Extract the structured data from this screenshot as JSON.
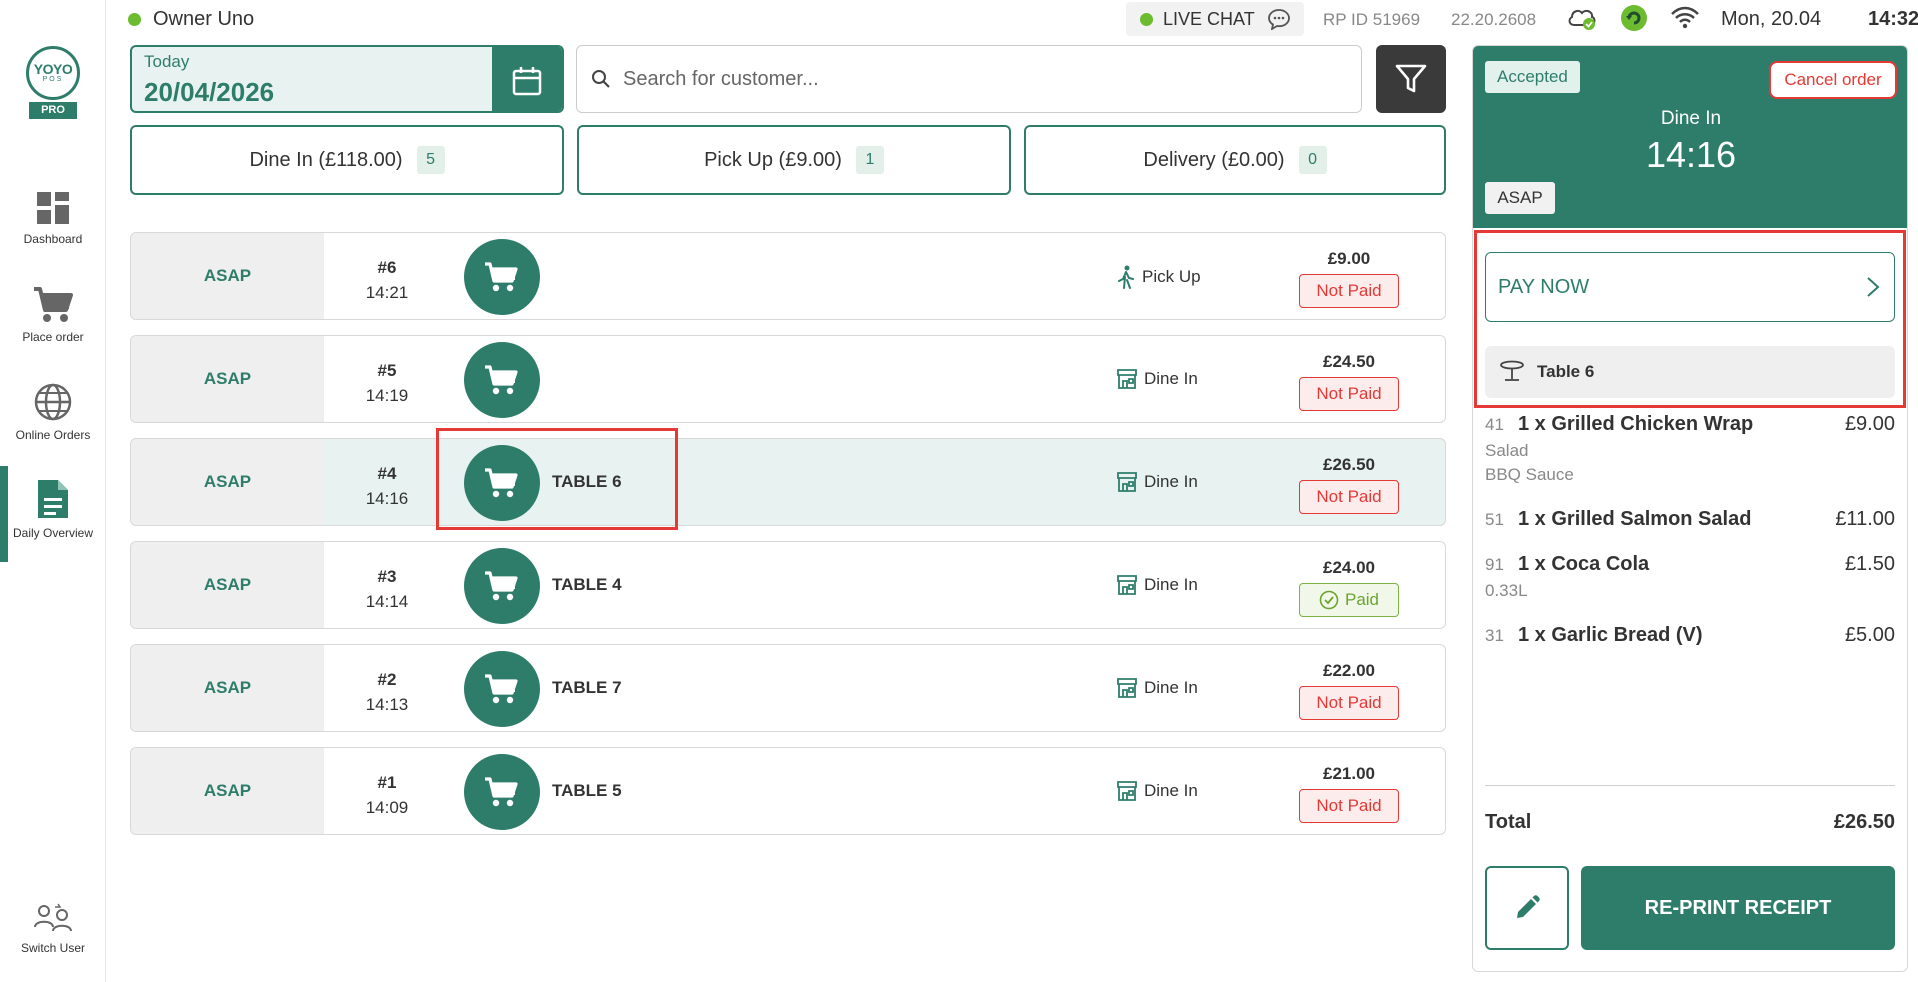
{
  "colors": {
    "brand": "#2e7d6b",
    "unpaid": "#e53935",
    "paid": "#6aa52f",
    "status_dot": "#6dbb2f",
    "highlight": "#e53935"
  },
  "logo": {
    "text": "YOYO",
    "sub": "POS",
    "pro": "PRO"
  },
  "sidebar": {
    "items": [
      {
        "label": "Dashboard",
        "icon": "dashboard-icon"
      },
      {
        "label": "Place order",
        "icon": "cart-icon"
      },
      {
        "label": "Online Orders",
        "icon": "globe-icon"
      },
      {
        "label": "Daily Overview",
        "icon": "document-icon",
        "active": true
      },
      {
        "label": "Switch User",
        "icon": "switch-user-icon"
      }
    ]
  },
  "topbar": {
    "owner": "Owner Uno",
    "live_chat": "LIVE CHAT",
    "rp_id": "RP ID 51969",
    "version": "22.20.2608",
    "date": "Mon, 20.04",
    "time": "14:32"
  },
  "date_filter": {
    "label": "Today",
    "value": "20/04/2026"
  },
  "search": {
    "placeholder": "Search for customer..."
  },
  "tabs": [
    {
      "label": "Dine In (£118.00)",
      "count": "5"
    },
    {
      "label": "Pick Up (£9.00)",
      "count": "1"
    },
    {
      "label": "Delivery (£0.00)",
      "count": "0"
    }
  ],
  "orders": [
    {
      "timing": "ASAP",
      "number": "#6",
      "time": "14:21",
      "table": "",
      "type": "Pick Up",
      "price": "£9.00",
      "status": "Not Paid"
    },
    {
      "timing": "ASAP",
      "number": "#5",
      "time": "14:19",
      "table": "",
      "type": "Dine In",
      "price": "£24.50",
      "status": "Not Paid"
    },
    {
      "timing": "ASAP",
      "number": "#4",
      "time": "14:16",
      "table": "TABLE 6",
      "type": "Dine In",
      "price": "£26.50",
      "status": "Not Paid"
    },
    {
      "timing": "ASAP",
      "number": "#3",
      "time": "14:14",
      "table": "TABLE 4",
      "type": "Dine In",
      "price": "£24.00",
      "status": "Paid"
    },
    {
      "timing": "ASAP",
      "number": "#2",
      "time": "14:13",
      "table": "TABLE 7",
      "type": "Dine In",
      "price": "£22.00",
      "status": "Not Paid"
    },
    {
      "timing": "ASAP",
      "number": "#1",
      "time": "14:09",
      "table": "TABLE 5",
      "type": "Dine In",
      "price": "£21.00",
      "status": "Not Paid"
    }
  ],
  "detail": {
    "status": "Accepted",
    "cancel_label": "Cancel order",
    "order_type": "Dine In",
    "time": "14:16",
    "timing": "ASAP",
    "pay_now": "PAY NOW",
    "table": "Table 6",
    "items": [
      {
        "code": "41",
        "name": "1 x Grilled Chicken Wrap",
        "price": "£9.00",
        "mods": [
          "Salad",
          "BBQ Sauce"
        ]
      },
      {
        "code": "51",
        "name": "1 x Grilled Salmon Salad",
        "price": "£11.00",
        "mods": []
      },
      {
        "code": "91",
        "name": "1 x Coca Cola",
        "price": "£1.50",
        "mods": [
          "0.33L"
        ]
      },
      {
        "code": "31",
        "name": "1 x Garlic Bread (V)",
        "price": "£5.00",
        "mods": []
      }
    ],
    "total_label": "Total",
    "total": "£26.50",
    "reprint_label": "RE-PRINT RECEIPT"
  }
}
